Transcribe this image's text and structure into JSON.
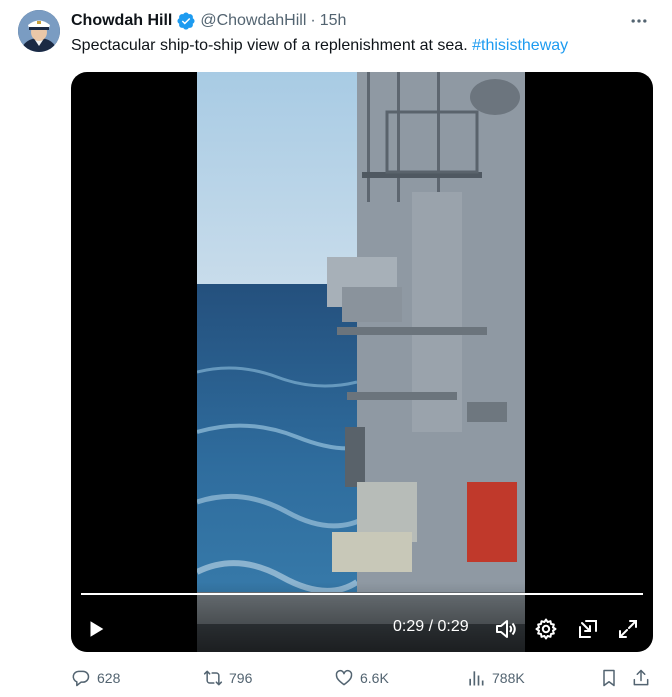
{
  "author": {
    "display_name": "Chowdah Hill",
    "handle": "@ChowdahHill",
    "separator": "·",
    "time": "15h",
    "avatar_icon": "avatar-portrait-icon",
    "verified_color": "#1d9bf0"
  },
  "tweet": {
    "text": "Spectacular ship-to-ship view of a replenishment at sea. ",
    "hashtag": "#thisistheway"
  },
  "video": {
    "timecode": "0:29 / 0:29",
    "progress": 1.0
  },
  "actions": {
    "replies": "628",
    "reposts": "796",
    "likes": "6.6K",
    "views": "788K"
  },
  "colors": {
    "text": "#0f1419",
    "secondary": "#536471",
    "accent": "#1d9bf0"
  }
}
